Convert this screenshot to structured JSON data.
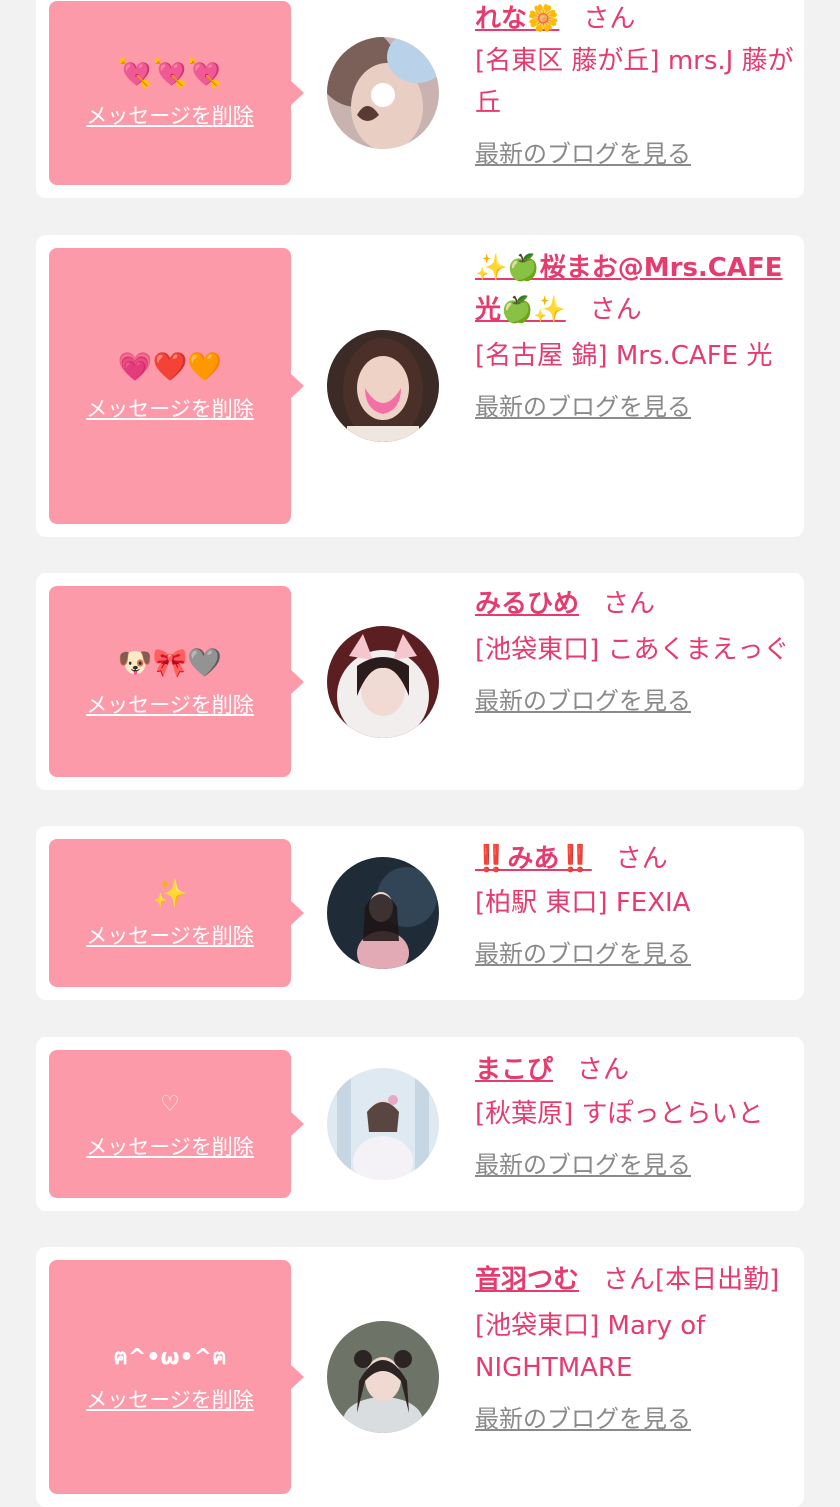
{
  "colors": {
    "accent": "#e53b6e",
    "message_bg": "#fd9aaa",
    "page_bg": "#f2f2f2"
  },
  "delete_label": "メッセージを削除",
  "san": "さん",
  "blog_label": "最新のブログを見る",
  "items": [
    {
      "emoji": "💘💘💘",
      "name": "れな🌼",
      "san_suffix": "",
      "shop": "[名東区 藤が丘] mrs.J 藤が丘"
    },
    {
      "emoji": "💗❤️🧡",
      "name": "✨🍏桜まお@Mrs.CAFE光🍏✨",
      "san_suffix": "",
      "shop": "[名古屋 錦] Mrs.CAFE 光"
    },
    {
      "emoji": "🐶🎀🩶",
      "name": "みるひめ",
      "san_suffix": "",
      "shop": "[池袋東口] こあくまえっぐ"
    },
    {
      "emoji": "✨",
      "name": "‼️みあ‼️",
      "san_suffix": "",
      "shop": "[柏駅 東口] FEXIA"
    },
    {
      "emoji": "♡",
      "name": "まこぴ",
      "san_suffix": "",
      "shop": "[秋葉原] すぽっとらいと"
    },
    {
      "emoji": "ฅ^•ω•^ฅ",
      "name": "音羽つむ",
      "san_suffix": "[本日出勤]",
      "shop": "[池袋東口] Mary of NIGHTMARE"
    }
  ]
}
